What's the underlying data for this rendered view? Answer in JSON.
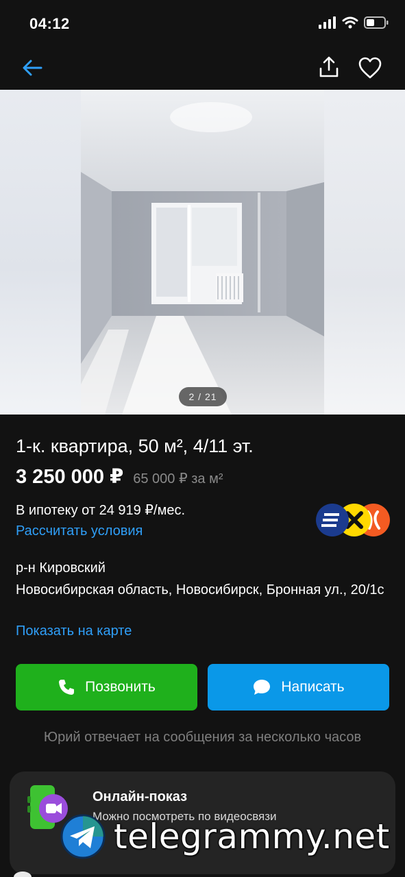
{
  "status_bar": {
    "time": "04:12"
  },
  "gallery": {
    "counter": "2 / 21"
  },
  "listing": {
    "title": "1-к. квартира, 50 м², 4/11 эт.",
    "price": "3 250 000 ₽",
    "price_per_m2": "65 000 ₽ за м²",
    "mortgage_text": "В ипотеку от 24 919 ₽/мес.",
    "mortgage_link": "Рассчитать условия",
    "district": "р-н Кировский",
    "address": "Новосибирская область, Новосибирск, Бронная ул., 20/1с",
    "map_link": "Показать на карте"
  },
  "actions": {
    "call_label": "Позвонить",
    "write_label": "Написать",
    "reply_note": "Юрий отвечает на сообщения за несколько часов"
  },
  "online_show": {
    "title": "Онлайн-показ",
    "subtitle": "Можно посмотреть по видеосвязи"
  },
  "watermark": {
    "text": "telegrammy.net"
  },
  "colors": {
    "background": "#121212",
    "link": "#2f9ff8",
    "call_button": "#1fb01c",
    "write_button": "#0a98e8",
    "muted_text": "#7f7f7f"
  },
  "icons": [
    "back-arrow-icon",
    "share-icon",
    "heart-icon",
    "phone-icon",
    "chat-bubble-icon",
    "video-call-icon",
    "telegram-icon"
  ]
}
